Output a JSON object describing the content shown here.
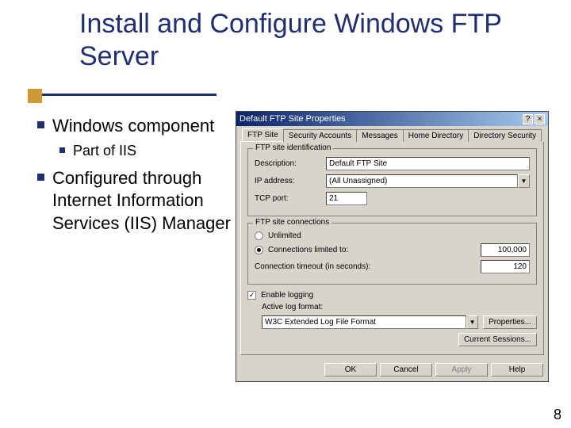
{
  "slide": {
    "title": "Install and Configure Windows FTP Server",
    "page_number": "8",
    "bullets": {
      "b1": "Windows component",
      "b1a": "Part of IIS",
      "b2": "Configured through Internet Information Services (IIS) Manager"
    }
  },
  "dialog": {
    "title": "Default FTP Site Properties",
    "close_icon": "×",
    "help_icon": "?",
    "tabs": {
      "ftp_site": "FTP Site",
      "security": "Security Accounts",
      "messages": "Messages",
      "home": "Home Directory",
      "dirsec": "Directory Security"
    },
    "group_identification": {
      "title": "FTP site identification",
      "description_label": "Description:",
      "description_value": "Default FTP Site",
      "ip_label": "IP address:",
      "ip_value": "(All Unassigned)",
      "tcp_label": "TCP port:",
      "tcp_value": "21"
    },
    "group_connections": {
      "title": "FTP site connections",
      "unlimited": "Unlimited",
      "limited": "Connections limited to:",
      "limited_value": "100,000",
      "timeout_label": "Connection timeout (in seconds):",
      "timeout_value": "120"
    },
    "logging": {
      "checkbox": "Enable logging",
      "format_label": "Active log format:",
      "format_value": "W3C Extended Log File Format",
      "properties_btn": "Properties..."
    },
    "current_sessions_btn": "Current Sessions...",
    "buttons": {
      "ok": "OK",
      "cancel": "Cancel",
      "apply": "Apply",
      "help": "Help"
    }
  }
}
